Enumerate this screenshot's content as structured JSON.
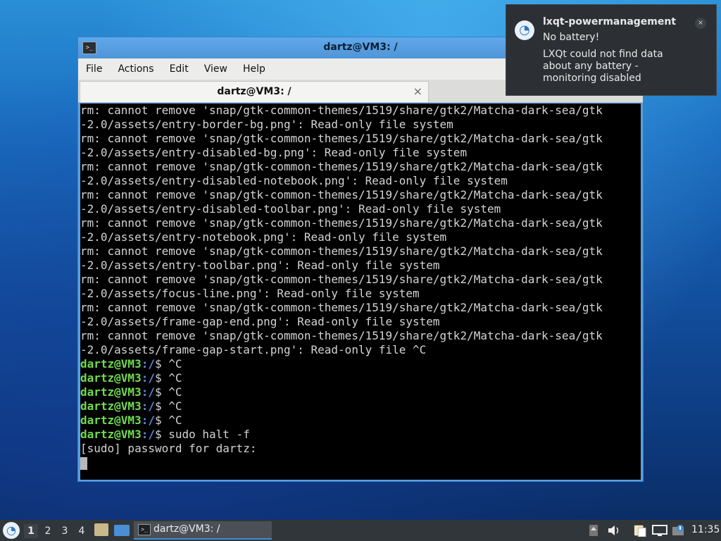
{
  "window": {
    "title": "dartz@VM3: /",
    "menu": [
      "File",
      "Actions",
      "Edit",
      "View",
      "Help"
    ],
    "tab_label": "dartz@VM3: /",
    "tab_close": "×"
  },
  "terminal": {
    "lines": [
      {
        "text": "rm: cannot remove 'snap/gtk-common-themes/1519/share/gtk2/Matcha-dark-sea/gtk"
      },
      {
        "text": "-2.0/assets/entry-border-bg.png': Read-only file system"
      },
      {
        "text": "rm: cannot remove 'snap/gtk-common-themes/1519/share/gtk2/Matcha-dark-sea/gtk"
      },
      {
        "text": "-2.0/assets/entry-disabled-bg.png': Read-only file system"
      },
      {
        "text": "rm: cannot remove 'snap/gtk-common-themes/1519/share/gtk2/Matcha-dark-sea/gtk"
      },
      {
        "text": "-2.0/assets/entry-disabled-notebook.png': Read-only file system"
      },
      {
        "text": "rm: cannot remove 'snap/gtk-common-themes/1519/share/gtk2/Matcha-dark-sea/gtk"
      },
      {
        "text": "-2.0/assets/entry-disabled-toolbar.png': Read-only file system"
      },
      {
        "text": "rm: cannot remove 'snap/gtk-common-themes/1519/share/gtk2/Matcha-dark-sea/gtk"
      },
      {
        "text": "-2.0/assets/entry-notebook.png': Read-only file system"
      },
      {
        "text": "rm: cannot remove 'snap/gtk-common-themes/1519/share/gtk2/Matcha-dark-sea/gtk"
      },
      {
        "text": "-2.0/assets/entry-toolbar.png': Read-only file system"
      },
      {
        "text": "rm: cannot remove 'snap/gtk-common-themes/1519/share/gtk2/Matcha-dark-sea/gtk"
      },
      {
        "text": "-2.0/assets/focus-line.png': Read-only file system"
      },
      {
        "text": "rm: cannot remove 'snap/gtk-common-themes/1519/share/gtk2/Matcha-dark-sea/gtk"
      },
      {
        "text": "-2.0/assets/frame-gap-end.png': Read-only file system"
      },
      {
        "text": "rm: cannot remove 'snap/gtk-common-themes/1519/share/gtk2/Matcha-dark-sea/gtk"
      },
      {
        "text": "-2.0/assets/frame-gap-start.png': Read-only file ^C"
      },
      {
        "user": "dartz@VM3",
        "path": ":/",
        "cmd": "$ ^C"
      },
      {
        "user": "dartz@VM3",
        "path": ":/",
        "cmd": "$ ^C"
      },
      {
        "user": "dartz@VM3",
        "path": ":/",
        "cmd": "$ ^C"
      },
      {
        "user": "dartz@VM3",
        "path": ":/",
        "cmd": "$ ^C"
      },
      {
        "user": "dartz@VM3",
        "path": ":/",
        "cmd": "$ ^C"
      },
      {
        "user": "dartz@VM3",
        "path": ":/",
        "cmd": "$ sudo halt -f"
      },
      {
        "text": "[sudo] password for dartz:"
      }
    ],
    "colors": {
      "user": "#6fdc4f",
      "path": "#5b8de8",
      "text": "#d3d3d3"
    }
  },
  "notification": {
    "app": "lxqt-powermanagement",
    "summary": "No battery!",
    "body": "LXQt could not find data about any battery - monitoring disabled",
    "close": "×"
  },
  "taskbar": {
    "workspaces": [
      "1",
      "2",
      "3",
      "4"
    ],
    "active_workspace": "1",
    "task_label": "dartz@VM3: /",
    "clock": "11:35"
  }
}
